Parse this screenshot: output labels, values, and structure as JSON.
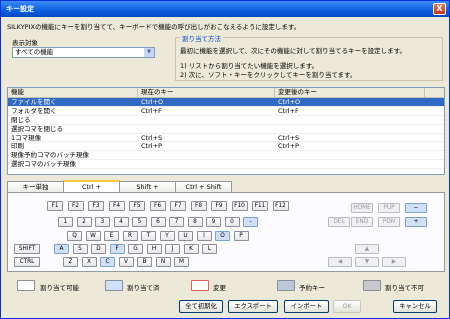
{
  "window": {
    "title": "キー設定",
    "close_glyph": "X"
  },
  "description": "SILKYPIXの機能にキーを割り当てて、キーボードで機能の呼び出しがおこなえるように設定します。",
  "filter": {
    "label": "表示対象",
    "value": "すべての機能"
  },
  "howto": {
    "title": "割り当て方法",
    "line1": "最初に機能を選択して、次にその機能に対して割り当てるキーを設定します。",
    "line2": "1) リストから割り当てたい機能を選択します。",
    "line3": "2) 次に、ソフト・キーをクリックしてキーを割り当てます。"
  },
  "table": {
    "headers": [
      "機能",
      "現在のキー",
      "変更後のキー"
    ],
    "rows": [
      [
        "ファイルを開く",
        "Ctrl+O",
        "Ctrl+O"
      ],
      [
        "フォルダを開く",
        "Ctrl+F",
        "Ctrl+F"
      ],
      [
        "閉じる",
        "",
        ""
      ],
      [
        "選択コマを閉じる",
        "",
        ""
      ],
      [
        "1コマ現像",
        "Ctrl+S",
        "Ctrl+S"
      ],
      [
        "印刷",
        "Ctrl+P",
        "Ctrl+P"
      ],
      [
        "現像予約コマのバッチ現像",
        "",
        ""
      ],
      [
        "選択コマのバッチ現像",
        "",
        ""
      ]
    ]
  },
  "tabs": [
    "キー単独",
    "Ctrl +",
    "Shift +",
    "Ctrl + Shift +"
  ],
  "keys": {
    "fn": [
      "F1",
      "F2",
      "F3",
      "F4",
      "F5",
      "F6",
      "F7",
      "F8",
      "F9",
      "F10",
      "F11",
      "F12"
    ],
    "num": [
      "1",
      "2",
      "3",
      "4",
      "5",
      "6",
      "7",
      "8",
      "9",
      "0",
      "-"
    ],
    "q": [
      "Q",
      "W",
      "E",
      "R",
      "T",
      "Y",
      "U",
      "I",
      "O",
      "P"
    ],
    "a": [
      "A",
      "S",
      "D",
      "F",
      "G",
      "H",
      "J",
      "K",
      "L"
    ],
    "z": [
      "Z",
      "X",
      "C",
      "V",
      "B",
      "N",
      "M"
    ],
    "shift": "SHIFT",
    "ctrl": "CTRL",
    "nav1": [
      "HOME",
      "PUP"
    ],
    "nav2": [
      "DEL",
      "END",
      "PDN"
    ],
    "minus": "−",
    "plus": "+",
    "arrows": [
      "▲",
      "◀",
      "▼",
      "▶"
    ]
  },
  "legend": [
    "割り当て可能",
    "割り当て済",
    "変更",
    "予約キー",
    "割り当て不可"
  ],
  "buttons": {
    "reset": "全て初期化",
    "export": "エクスポート",
    "import": "インポート",
    "ok": "OK",
    "cancel": "キャンセル"
  },
  "colors": {
    "selection": "#316ac5",
    "assigned": "#cfe0f8",
    "changed": "#f4a0a0",
    "reserved": "#bcc7d9",
    "disabled": "#c8c8c8"
  }
}
